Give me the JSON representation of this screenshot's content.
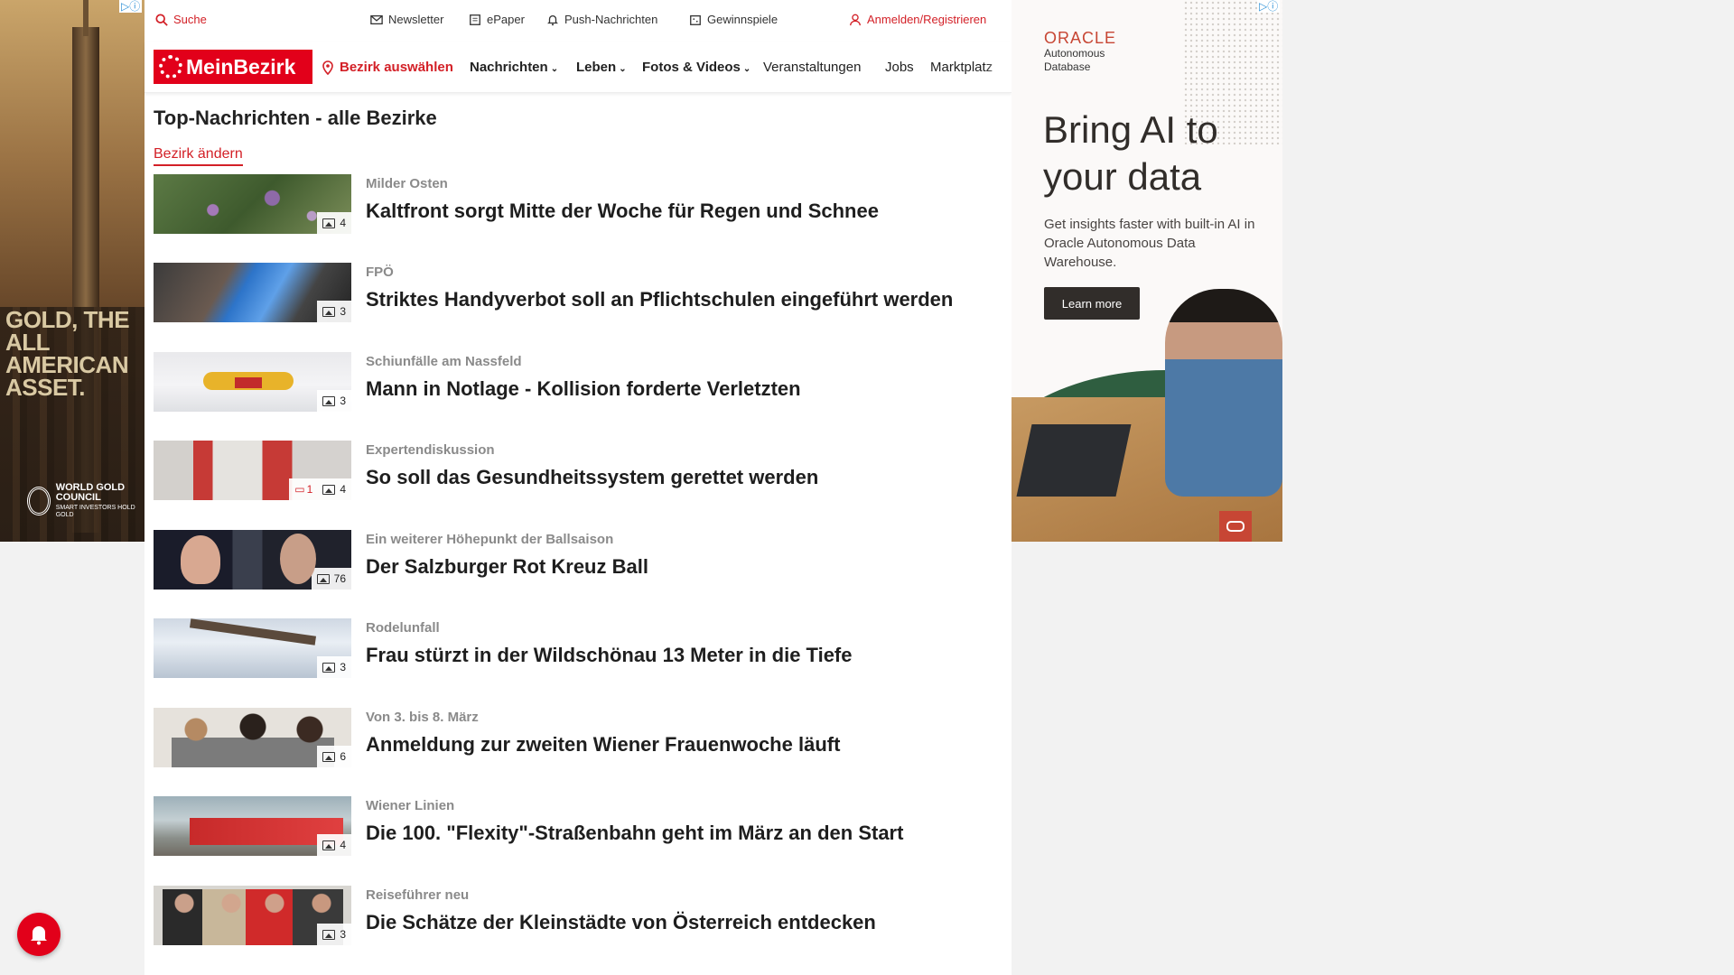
{
  "left_ad": {
    "headline": "GOLD, THE ALL AMERICAN ASSET.",
    "brand": "WORLD GOLD COUNCIL",
    "tagline": "SMART INVESTORS HOLD GOLD"
  },
  "topbar": {
    "search": "Suche",
    "newsletter": "Newsletter",
    "epaper": "ePaper",
    "push": "Push-Nachrichten",
    "games": "Gewinnspiele",
    "login": "Anmelden/Registrieren"
  },
  "nav": {
    "logo": "MeinBezirk",
    "district_select": "Bezirk auswählen",
    "items": [
      "Nachrichten",
      "Leben",
      "Fotos & Videos",
      "Veranstaltungen",
      "Jobs",
      "Marktplatz"
    ]
  },
  "page": {
    "title": "Top-Nachrichten - alle Bezirke",
    "change_district": "Bezirk ändern"
  },
  "articles": [
    {
      "kicker": "Milder Osten",
      "headline": "Kaltfront sorgt Mitte der Woche für Regen und Schnee",
      "images": "4"
    },
    {
      "kicker": "FPÖ",
      "headline": "Striktes Handyverbot soll an Pflichtschulen eingeführt werden",
      "images": "3"
    },
    {
      "kicker": "Schiunfälle am Nassfeld",
      "headline": "Mann in Notlage - Kollision forderte Verletzten",
      "images": "3"
    },
    {
      "kicker": "Expertendiskussion",
      "headline": "So soll das Gesundheitssystem gerettet werden",
      "images": "4",
      "comments": "1"
    },
    {
      "kicker": "Ein weiterer Höhepunkt der Ballsaison",
      "headline": "Der Salzburger Rot Kreuz Ball",
      "images": "76"
    },
    {
      "kicker": "Rodelunfall",
      "headline": "Frau stürzt in der Wildschönau 13 Meter in die Tiefe",
      "images": "3"
    },
    {
      "kicker": "Von 3. bis 8. März",
      "headline": "Anmeldung zur zweiten Wiener Frauenwoche läuft",
      "images": "6"
    },
    {
      "kicker": "Wiener Linien",
      "headline": "Die 100. \"Flexity\"-Straßenbahn geht im März an den Start",
      "images": "4"
    },
    {
      "kicker": "Reiseführer neu",
      "headline": "Die Schätze der Kleinstädte von Österreich entdecken",
      "images": "3"
    }
  ],
  "right_ad": {
    "brand": "ORACLE",
    "product": "Autonomous Database",
    "headline": "Bring AI to your data",
    "body": "Get insights faster with built-in AI in Oracle Autonomous Data Warehouse.",
    "cta": "Learn more"
  },
  "colors": {
    "brand_red": "#e2001a",
    "link_red": "#d32027"
  }
}
